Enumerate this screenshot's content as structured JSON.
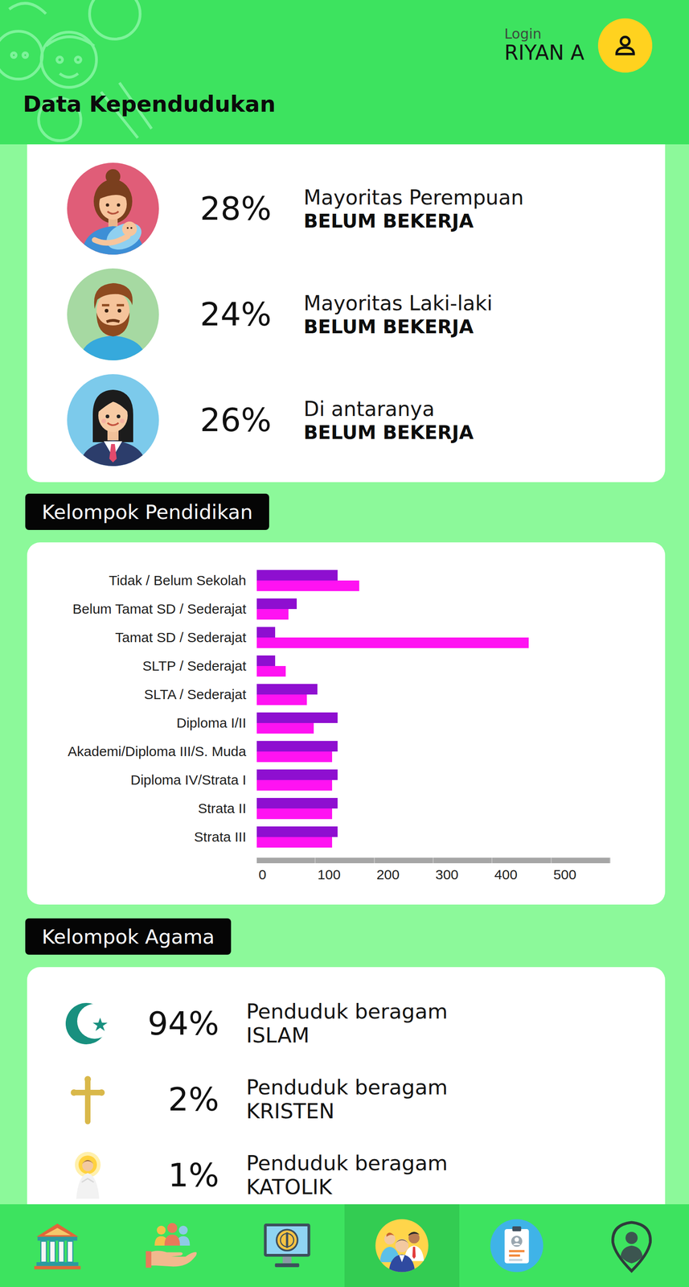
{
  "header": {
    "title": "Data Kependudukan",
    "login_label": "Login",
    "user_name": "RIYAN A"
  },
  "employment": [
    {
      "percent": "28%",
      "label": "Mayoritas Perempuan",
      "status": "BELUM BEKERJA"
    },
    {
      "percent": "24%",
      "label": "Mayoritas Laki-laki",
      "status": "BELUM BEKERJA"
    },
    {
      "percent": "26%",
      "label": "Di antaranya",
      "status": "BELUM BEKERJA"
    }
  ],
  "education": {
    "title": "Kelompok Pendidikan",
    "categories": [
      "Tidak / Belum Sekolah",
      "Belum Tamat SD / Sederajat",
      "Tamat SD / Sederajat",
      "SLTP / Sederajat",
      "SLTA / Sederajat",
      "Diploma I/II",
      "Akademi/Diploma III/S. Muda",
      "Diploma IV/Strata I",
      "Strata II",
      "Strata III"
    ],
    "series": [
      {
        "color": "#8e0fd0",
        "values": [
          137,
          68,
          31,
          31,
          103,
          137,
          137,
          137,
          137,
          137
        ]
      },
      {
        "color": "#ff12f2",
        "values": [
          174,
          54,
          461,
          49,
          85,
          97,
          128,
          128,
          128,
          128
        ]
      }
    ],
    "ticks": [
      "0",
      "100",
      "200",
      "300",
      "400",
      "500"
    ]
  },
  "religion": {
    "title": "Kelompok Agama",
    "items": [
      {
        "percent": "94%",
        "label": "Penduduk beragam",
        "name": "ISLAM"
      },
      {
        "percent": "2%",
        "label": "Penduduk beragam",
        "name": "KRISTEN"
      },
      {
        "percent": "1%",
        "label": "Penduduk beragam",
        "name": "KATOLIK"
      }
    ]
  },
  "nav": {
    "items": [
      {
        "selected": false
      },
      {
        "selected": false
      },
      {
        "selected": false
      },
      {
        "selected": true
      },
      {
        "selected": false
      },
      {
        "selected": false
      }
    ]
  }
}
